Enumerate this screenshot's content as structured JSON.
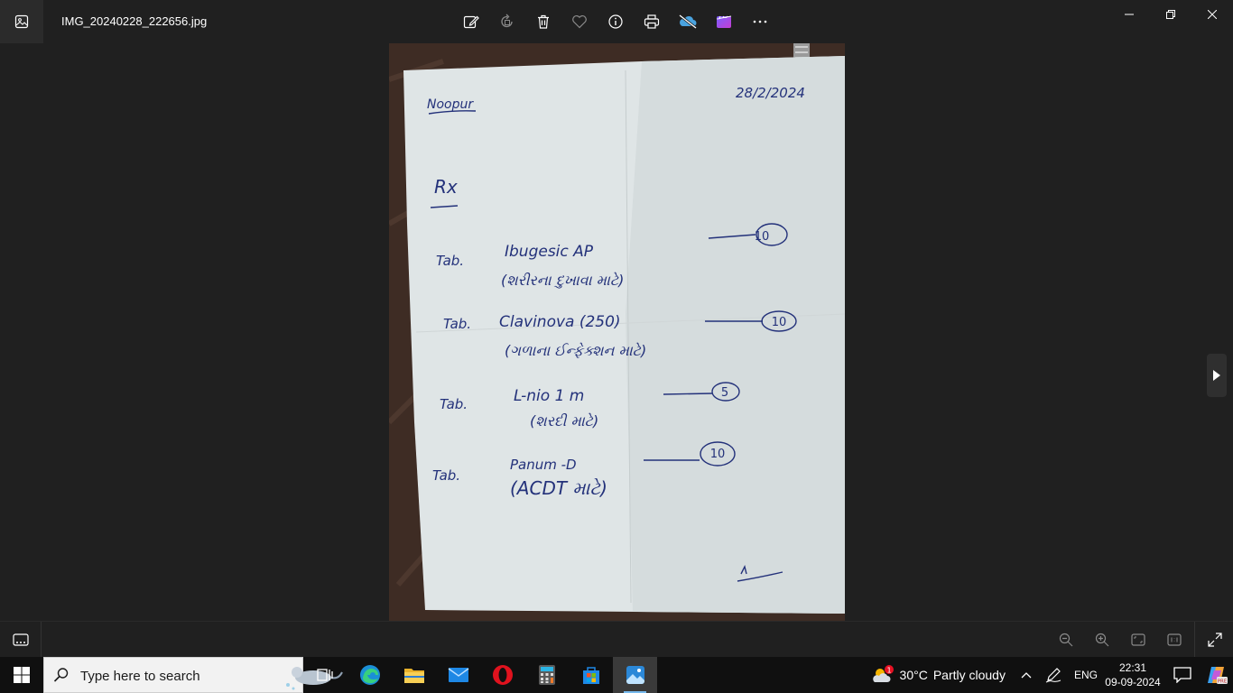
{
  "window": {
    "file_name": "IMG_20240228_222656.jpg",
    "toolbar_icons": [
      "edit-icon",
      "rotate-icon",
      "delete-icon",
      "favorite-icon",
      "info-icon",
      "print-icon",
      "onedrive-off-icon",
      "clipchamp-icon",
      "more-icon"
    ],
    "controls": [
      "minimize-icon",
      "restore-icon",
      "close-icon"
    ]
  },
  "photo": {
    "name": "Noopur",
    "date": "28/2/2024",
    "rx": "Rx",
    "items": [
      {
        "prefix": "Tab.",
        "drug": "Ibugesic AP",
        "note": "(શરીરના દુખાવા માટે)",
        "qty": "10"
      },
      {
        "prefix": "Tab.",
        "drug": "Clavinova (250)",
        "note": "(ગળાના ઈન્ફેક્શન માટે)",
        "qty": "10"
      },
      {
        "prefix": "Tab.",
        "drug": "L-nio 1 m",
        "note": "(શરદી માટે)",
        "qty": "5"
      },
      {
        "prefix": "Tab.",
        "drug": "Panum -D",
        "note": "(ACDT માટે)",
        "qty": "10"
      }
    ]
  },
  "bottom_bar": {
    "icons": [
      "filmstrip-icon",
      "zoom-out-icon",
      "zoom-in-icon",
      "fit-icon",
      "actual-size-icon",
      "fullscreen-icon"
    ]
  },
  "taskbar": {
    "search_placeholder": "Type here to search",
    "apps": [
      "task-view",
      "edge",
      "file-explorer",
      "mail",
      "opera",
      "calculator",
      "store",
      "photos"
    ],
    "weather_temp": "30°C",
    "weather_desc": "Partly cloudy",
    "weather_badge": "1",
    "language": "ENG",
    "time": "22:31",
    "date": "09-09-2024"
  },
  "colors": {
    "accent": "#76b9ed",
    "ink": "#23317a",
    "paper": "#dfe5e6",
    "table": "#3e2c24"
  }
}
